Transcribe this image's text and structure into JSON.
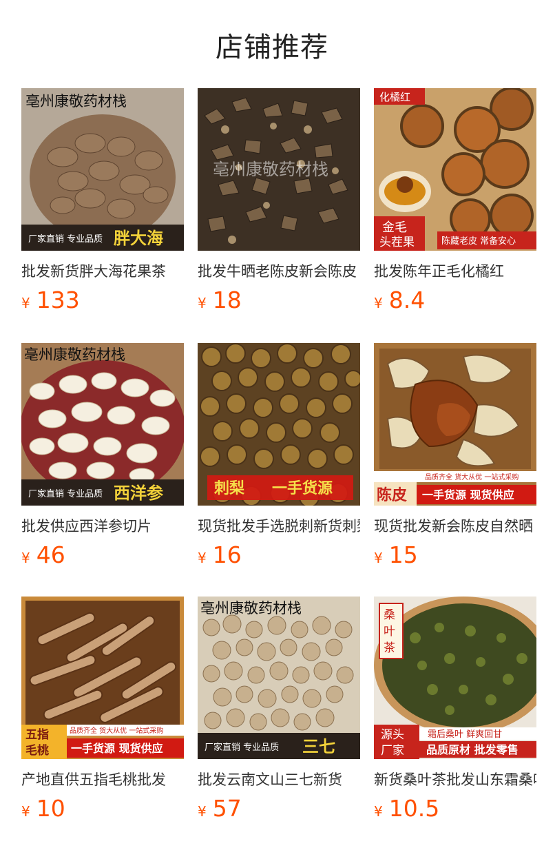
{
  "section": {
    "title": "店铺推荐"
  },
  "products": [
    {
      "title": "批发新货胖大海花果茶",
      "currency": "¥",
      "price": "133",
      "image": {
        "watermark": "亳州康敬药材栈",
        "footer_left": "厂家直销 专业品质",
        "footer_right": "胖大海"
      }
    },
    {
      "title": "批发牛晒老陈皮新会陈皮",
      "currency": "¥",
      "price": "18",
      "image": {
        "watermark": "亳州康敬药材栈"
      }
    },
    {
      "title": "批发陈年正毛化橘红",
      "currency": "¥",
      "price": "8.4",
      "image": {
        "top_tag": "化橘红",
        "bottom_left_1": "金毛",
        "bottom_left_2": "头茬果",
        "bottom_right": "陈藏老皮 常备安心"
      }
    },
    {
      "title": "批发供应西洋参切片",
      "currency": "¥",
      "price": "46",
      "image": {
        "watermark": "亳州康敬药材栈",
        "footer_left": "厂家直销 专业品质",
        "footer_right": "西洋参"
      }
    },
    {
      "title": "现货批发手选脱刺新货刺梨",
      "currency": "¥",
      "price": "16",
      "image": {
        "banner_left": "刺梨",
        "banner_right": "一手货源"
      }
    },
    {
      "title": "现货批发新会陈皮自然晒",
      "currency": "¥",
      "price": "15",
      "image": {
        "tagline": "品质齐全 货大从优 一站式采购",
        "bottom_left": "陈皮",
        "bottom_right": "一手货源 现货供应"
      }
    },
    {
      "title": "产地直供五指毛桃批发",
      "currency": "¥",
      "price": "10",
      "image": {
        "tagline": "品质齐全 货大从优 一站式采购",
        "bottom_left_1": "五指",
        "bottom_left_2": "毛桃",
        "bottom_right": "一手货源 现货供应"
      }
    },
    {
      "title": "批发云南文山三七新货",
      "currency": "¥",
      "price": "57",
      "image": {
        "watermark": "亳州康敬药材栈",
        "footer_left": "厂家直销 专业品质",
        "footer_right": "三七"
      }
    },
    {
      "title": "新货桑叶茶批发山东霜桑叶",
      "currency": "¥",
      "price": "10.5",
      "image": {
        "side_label": "桑叶茶",
        "bottom_left_1": "源头",
        "bottom_left_2": "厂家",
        "tagline": "霜后桑叶 鲜爽回甘",
        "bottom_right": "品质原材 批发零售"
      }
    }
  ]
}
